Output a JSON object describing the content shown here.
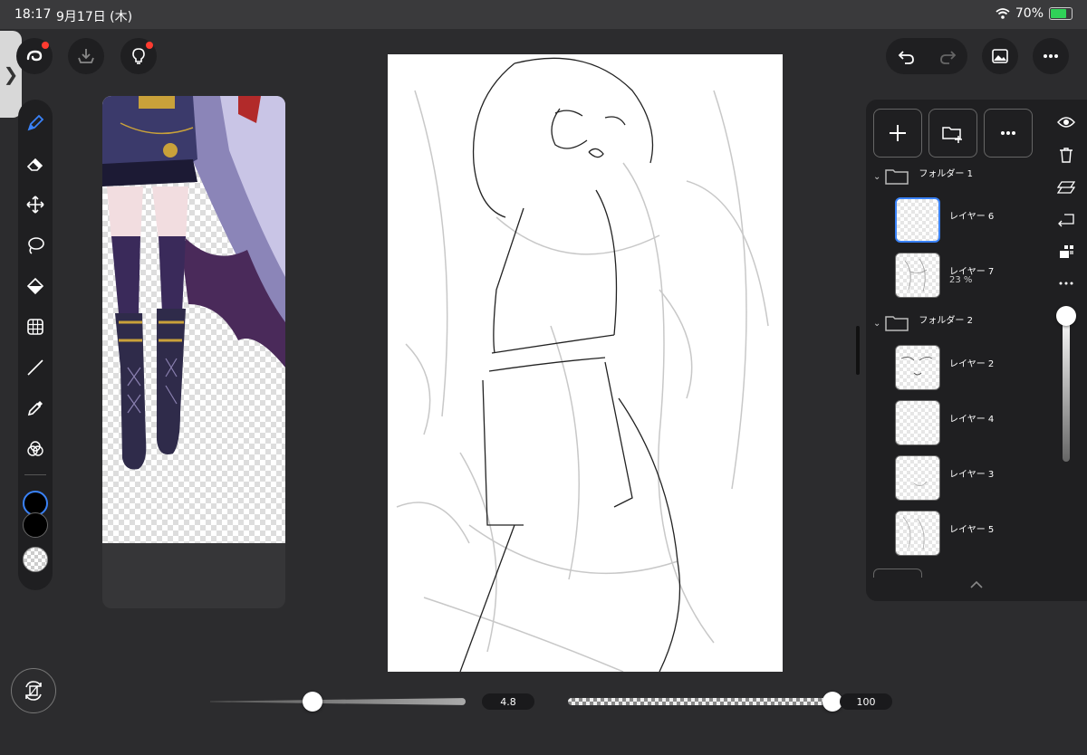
{
  "status_bar": {
    "time": "18:17",
    "date": "9月17日 (木)",
    "battery": "70%",
    "battery_level": 0.7
  },
  "top_left_buttons": [
    {
      "icon": "app-logo-icon",
      "has_badge": true
    },
    {
      "icon": "download-icon",
      "has_badge": false
    },
    {
      "icon": "lightbulb-icon",
      "has_badge": true
    }
  ],
  "toolbar": {
    "tools": [
      "pen-icon",
      "eraser-icon",
      "move-icon",
      "lasso-icon",
      "fill-icon",
      "grid-icon",
      "line-icon",
      "eyedropper-icon",
      "blend-icon"
    ],
    "active_tool": "pen-icon",
    "colors": [
      "#000000",
      "#000000",
      "transparent"
    ]
  },
  "top_right_buttons": [
    "undo-icon",
    "redo-icon",
    "gallery-icon",
    "more-icon"
  ],
  "layers": {
    "toolbar_buttons": [
      "add-layer-icon",
      "add-folder-icon",
      "more-icon"
    ],
    "folders": [
      {
        "name": "フォルダー 1",
        "layers": [
          {
            "name": "レイヤー 6",
            "opacity": "",
            "selected": true
          },
          {
            "name": "レイヤー 7",
            "opacity": "23 %",
            "selected": false
          }
        ]
      },
      {
        "name": "フォルダー 2",
        "layers": [
          {
            "name": "レイヤー 2",
            "opacity": "",
            "selected": false
          },
          {
            "name": "レイヤー 4",
            "opacity": "",
            "selected": false
          },
          {
            "name": "レイヤー 3",
            "opacity": "",
            "selected": false
          },
          {
            "name": "レイヤー 5",
            "opacity": "",
            "selected": false
          }
        ]
      }
    ],
    "side_icons": [
      "visibility-icon",
      "trash-icon",
      "merge-icon",
      "move-layer-icon",
      "alpha-lock-icon",
      "more-icon"
    ],
    "panel_opacity_level": 1.0
  },
  "bottom": {
    "brush_size_value": "4.8",
    "brush_size_level": 0.4,
    "brush_opacity_value": "100",
    "brush_opacity_level": 1.0
  },
  "colors": {
    "accent": "#3a82f7",
    "badge": "#ff3b30",
    "panel": "#1f1f21",
    "background": "#2c2c2e"
  }
}
